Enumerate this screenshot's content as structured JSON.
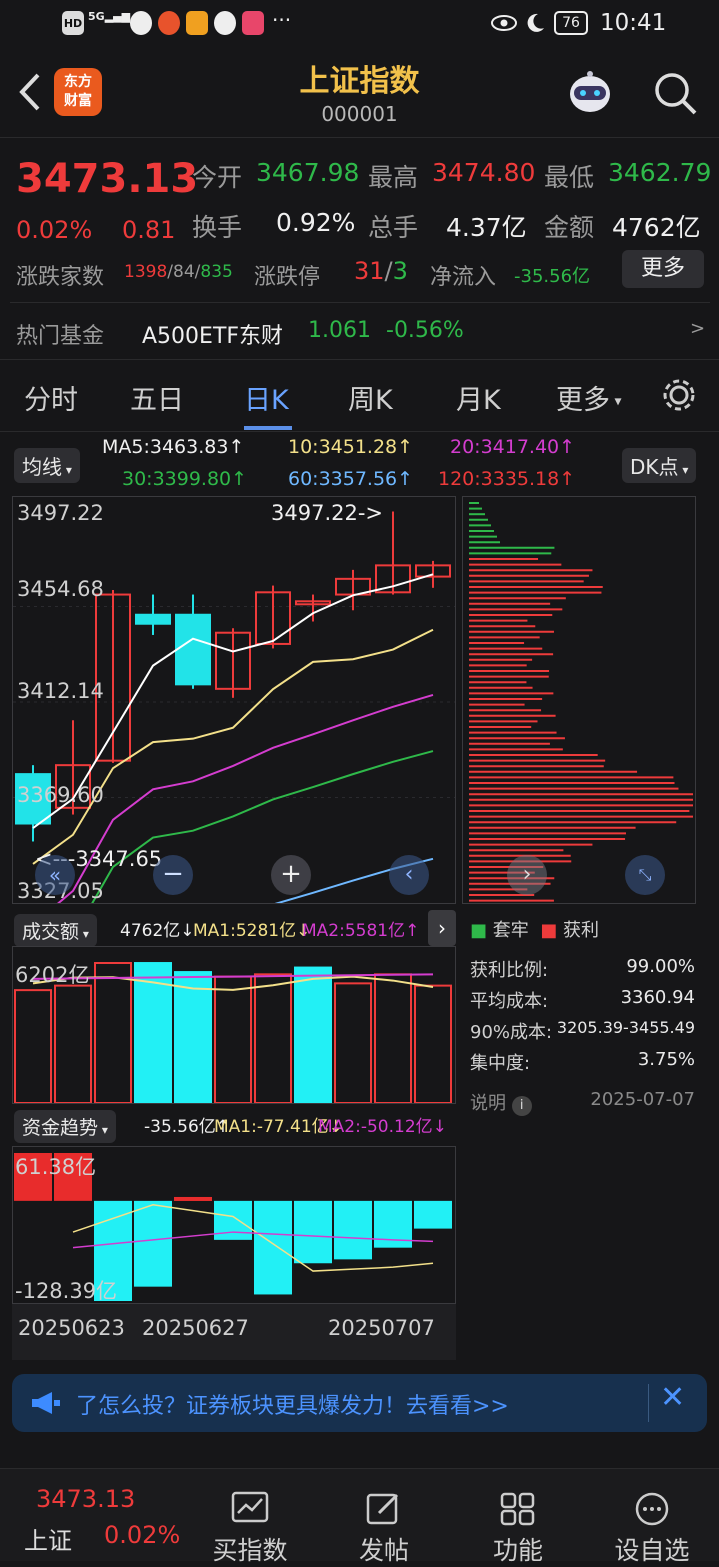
{
  "status": {
    "time": "10:41",
    "battery": "76",
    "signal": "5G"
  },
  "header": {
    "title": "上证指数",
    "code": "000001",
    "logo": "东方\n财富",
    "back_icon": "chevron-left-icon",
    "search_icon": "search-icon"
  },
  "quote": {
    "price": "3473.13",
    "change_pct": "0.02%",
    "change": "0.81",
    "open_label": "今开",
    "open": "3467.98",
    "high_label": "最高",
    "high": "3474.80",
    "low_label": "最低",
    "low": "3462.79",
    "turnover_label": "换手",
    "turnover": "0.92%",
    "volume_label": "总手",
    "volume": "4.37亿",
    "amount_label": "金额",
    "amount": "4762亿",
    "breadth_label": "涨跌家数",
    "breadth_up": "1398",
    "breadth_flat": "84",
    "breadth_down": "835",
    "limit_label": "涨跌停",
    "limit_up": "31",
    "limit_down": "3",
    "inflow_label": "净流入",
    "inflow": "-35.56亿",
    "more_btn": "更多",
    "fund_label": "热门基金",
    "fund_name": "A500ETF东财",
    "fund_price": "1.061",
    "fund_pct": "-0.56%"
  },
  "tabs": [
    "分时",
    "五日",
    "日K",
    "周K",
    "月K",
    "更多"
  ],
  "active_tab": "日K",
  "ma_bar": {
    "selector": "均线",
    "dk": "DK点",
    "ma5": "MA5:3463.83↑",
    "ma10": "10:3451.28↑",
    "ma20": "20:3417.40↑",
    "ma30": "30:3399.80↑",
    "ma60": "60:3357.56↑",
    "ma120": "120:3335.18↑"
  },
  "kchart": {
    "y_labels": [
      "3497.22",
      "3454.68",
      "3412.14",
      "3369.60",
      "3327.05"
    ],
    "max_marker": "3497.22->",
    "min_marker": "<---3347.65"
  },
  "volume_bar": {
    "selector": "成交额",
    "value": "4762亿↓",
    "ma1": "MA1:5281亿↓",
    "ma2": "MA2:5581亿↑",
    "y_label": "6202亿"
  },
  "fund_bar": {
    "selector": "资金趋势",
    "value": "-35.56亿↑",
    "ma1": "MA1:-77.41亿↓",
    "ma2": "MA2:-50.12亿↓",
    "y_top": "61.38亿",
    "y_bottom": "-128.39亿"
  },
  "dates": [
    "20250623",
    "20250627",
    "20250707"
  ],
  "chips": {
    "legend_trap": "套牢",
    "legend_profit": "获利",
    "rows": [
      [
        "获利比例:",
        "99.00%"
      ],
      [
        "平均成本:",
        "3360.94"
      ],
      [
        "90%成本:",
        "3205.39-3455.49"
      ],
      [
        "集中度:",
        "3.75%"
      ]
    ],
    "note": "说明",
    "date": "2025-07-07"
  },
  "banner": {
    "text": "了怎么投？证券板块更具爆发力！去看看>>"
  },
  "bottom": {
    "price": "3473.13",
    "name": "上证",
    "pct": "0.02%",
    "items": [
      "买指数",
      "发帖",
      "功能",
      "设自选"
    ]
  },
  "chart_data": {
    "type": "candlestick",
    "candles": [
      {
        "o": 3380,
        "c": 3358,
        "h": 3384,
        "l": 3350
      },
      {
        "o": 3365,
        "c": 3384,
        "h": 3404,
        "l": 3362
      },
      {
        "o": 3386,
        "c": 3460,
        "h": 3462,
        "l": 3385
      },
      {
        "o": 3451,
        "c": 3447,
        "h": 3460,
        "l": 3442
      },
      {
        "o": 3451,
        "c": 3420,
        "h": 3460,
        "l": 3418
      },
      {
        "o": 3418,
        "c": 3443,
        "h": 3445,
        "l": 3414
      },
      {
        "o": 3438,
        "c": 3461,
        "h": 3464,
        "l": 3436
      },
      {
        "o": 3457,
        "c": 3457,
        "h": 3460,
        "l": 3448
      },
      {
        "o": 3460,
        "c": 3467,
        "h": 3471,
        "l": 3453
      },
      {
        "o": 3461,
        "c": 3473,
        "h": 3497,
        "l": 3460
      },
      {
        "o": 3468,
        "c": 3473,
        "h": 3475,
        "l": 3463
      }
    ],
    "amount": [
      5000,
      5200,
      6202,
      6200,
      5800,
      5600,
      5700,
      6000,
      5300,
      5700,
      5200
    ],
    "flow": [
      61.38,
      61.38,
      -128.39,
      -110,
      5,
      -50,
      -120,
      -80,
      -75,
      -60,
      -35.56
    ]
  }
}
